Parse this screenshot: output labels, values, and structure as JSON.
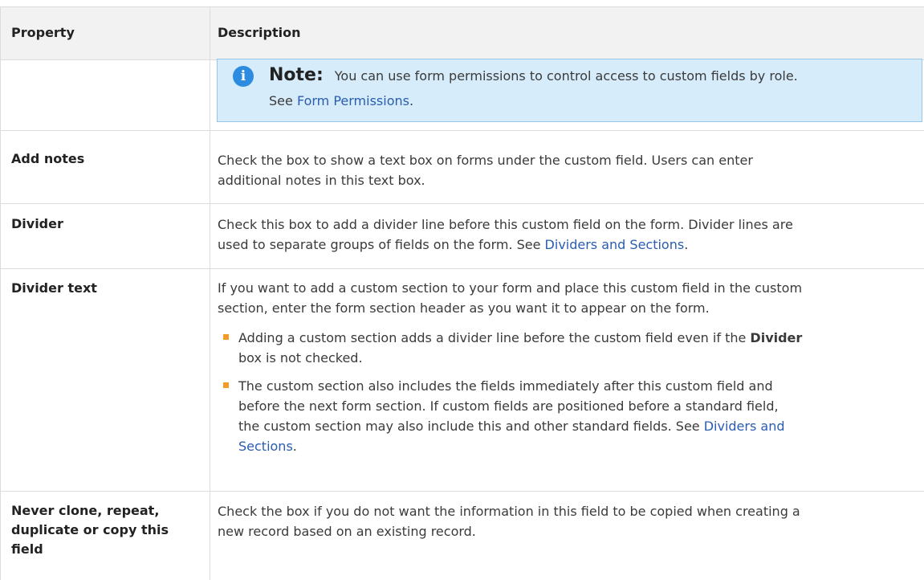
{
  "header": {
    "property": "Property",
    "description": "Description"
  },
  "note": {
    "label": "Note:",
    "text": "You can use form permissions to control access to custom fields by role.",
    "see_prefix": "See ",
    "link": "Form Permissions",
    "suffix": "."
  },
  "rows": [
    {
      "property": "Add notes",
      "description_lines": [
        "Check the box to show a text box on forms under the custom field. Users can enter",
        "additional notes in this text box."
      ]
    },
    {
      "property": "Divider",
      "description_lines": [
        "Check this box to add a divider line before this custom field on the form. Divider lines are",
        "used to separate groups of fields on the form. See "
      ],
      "link": "Dividers and Sections",
      "suffix": "."
    },
    {
      "property": "Divider text",
      "description_lines": [
        "If you want to add a custom section to your form and place this custom field in the custom",
        "section, enter the form section header as you want it to appear on the form."
      ],
      "bullets": [
        {
          "line1": "Adding a custom section adds a divider line before the custom field even if the ",
          "bold": "Divider",
          "line2": "box is not checked."
        },
        {
          "line1": "The custom section also includes the fields immediately after this custom field and",
          "line2": "before the next form section. If custom fields are positioned before a standard field,",
          "line3": "the custom section may also include this and other standard fields. See ",
          "link_part1": "Dividers and",
          "link_part2": "Sections",
          "suffix": "."
        }
      ]
    },
    {
      "property_lines": [
        "Never clone, repeat,",
        "duplicate or copy this",
        "field"
      ],
      "description_lines": [
        "Check the box if you do not want the information in this field to be copied when creating a",
        "new record based on an existing record."
      ]
    }
  ],
  "colors": {
    "link": "#2a5db0",
    "note_bg": "#d6ecfb",
    "note_border": "#98c7ea",
    "note_icon": "#2d8be0",
    "bullet": "#f39a28",
    "header_bg": "#f2f2f2"
  },
  "icons": {
    "note": "info-icon",
    "bullet": "square-bullet"
  }
}
